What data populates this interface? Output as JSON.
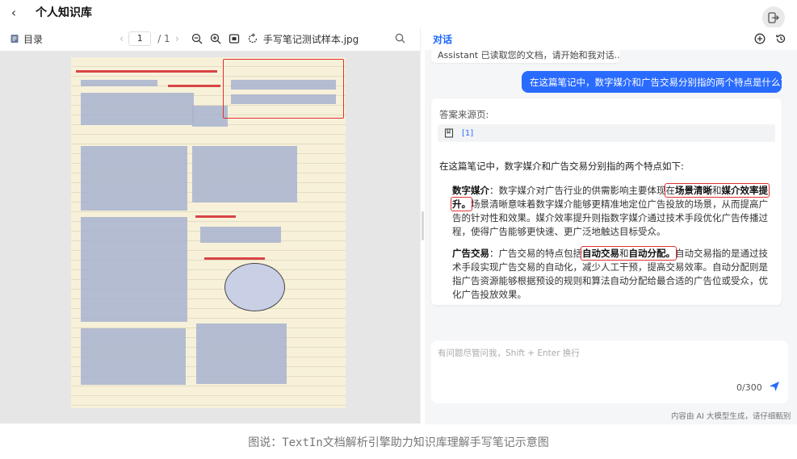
{
  "header": {
    "back_icon": "chevron-left-icon",
    "title": "个人知识库",
    "exit_icon": "exit-icon"
  },
  "viewer": {
    "toc_label": "目录",
    "page_current": "1",
    "page_total": "/ 1",
    "file_name": "手写笔记测试样本.jpg",
    "tools": [
      "zoom-out-icon",
      "zoom-in-icon",
      "fit-icon",
      "rotate-icon",
      "search-icon"
    ]
  },
  "chat": {
    "title": "对话",
    "prev_message": "Assistant 已读取您的文档，请开始和我对话...",
    "user_question": "在这篇笔记中，数字媒介和广告交易分别指的两个特点是什么?",
    "source_label": "答案来源页:",
    "source_ref": "[1]",
    "answer_intro": "在这篇笔记中，数字媒介和广告交易分别指的两个特点如下:",
    "p1_term": "数字媒介",
    "p1_a": "：数字媒介对广告行业的供需影响主要体现",
    "p1_b": "在",
    "p1_h1": "场景清晰",
    "p1_c": "和",
    "p1_h2": "媒介效率提升。",
    "p1_rest": "场景清晰意味着数字媒介能够更精准地定位广告投放的场景，从而提高广告的针对性和效果。媒介效率提升则指数字媒介通过技术手段优化广告传播过程，使得广告能够更快速、更广泛地触达目标受众。",
    "p2_term": "广告交易",
    "p2_a": "：广告交易的特点包括",
    "p2_h1": "自动交易",
    "p2_c": "和",
    "p2_h2": "自动分配。",
    "p2_rest": "自动交易指的是通过技术手段实现广告交易的自动化，减少人工干预，提高交易效率。自动分配则是指广告资源能够根据预设的规则和算法自动分配给最合适的广告位或受众，优化广告投放效果。",
    "input_placeholder": "有问题尽管问我，Shift + Enter 换行",
    "counter": "0/300",
    "footnote": "内容由 AI 大模型生成，请仔细甄别"
  },
  "caption": "图说：TextIn文档解析引擎助力知识库理解手写笔记示意图",
  "colors": {
    "accent": "#2a6bff",
    "highlight_border": "#e03030"
  }
}
